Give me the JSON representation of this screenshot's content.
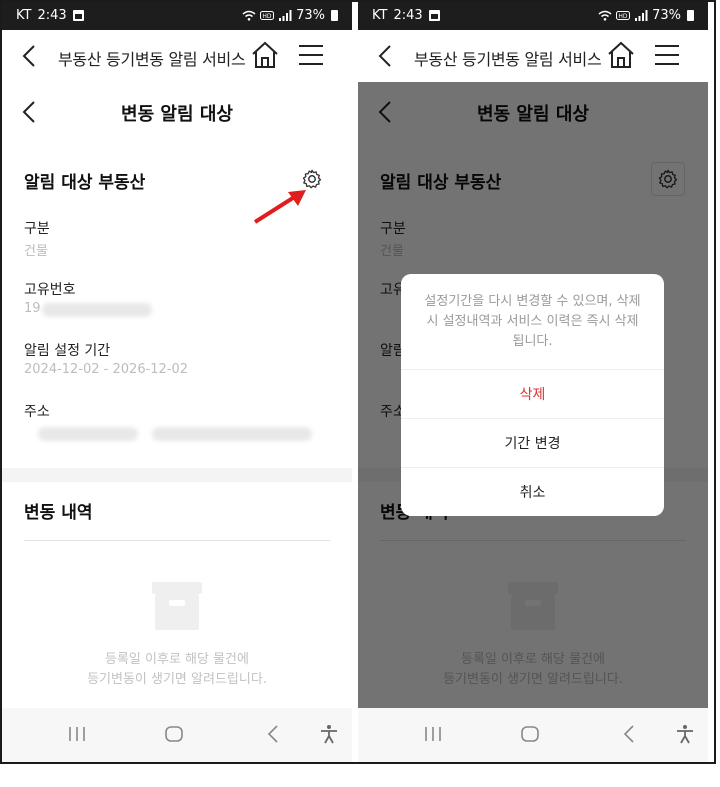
{
  "status": {
    "carrier": "KT",
    "time": "2:43",
    "battery": "73%"
  },
  "app": {
    "title": "부동산 등기변동 알림 서비스"
  },
  "page": {
    "title": "변동 알림 대상"
  },
  "property": {
    "section_title": "알림 대상 부동산",
    "fields": [
      {
        "label": "구분",
        "value": "건물"
      },
      {
        "label": "고유번호",
        "value": "19"
      },
      {
        "label": "알림 설정 기간",
        "value": "2024-12-02 - 2026-12-02"
      },
      {
        "label": "주소",
        "value": ""
      }
    ]
  },
  "changes": {
    "section_title": "변동 내역",
    "empty_line1": "등록일 이후로 해당 물건에",
    "empty_line2": "등기변동이 생기면 알려드립니다."
  },
  "dialog": {
    "message": "설정기간을 다시 변경할 수 있으며, 삭제 시 설정내역과 서비스 이력은 즉시 삭제됩니다.",
    "options": [
      "삭제",
      "기간 변경",
      "취소"
    ]
  },
  "colors": {
    "statusbar": "#1d1d1d",
    "danger": "#d33333",
    "annotation": "#e01e1e"
  }
}
